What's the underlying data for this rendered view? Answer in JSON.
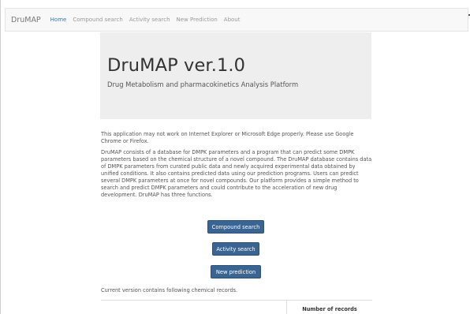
{
  "navbar": {
    "brand": "DruMAP",
    "items": [
      {
        "label": "Home",
        "active": true
      },
      {
        "label": "Compound search",
        "active": false
      },
      {
        "label": "Activity search",
        "active": false
      },
      {
        "label": "New Prediction",
        "active": false
      },
      {
        "label": "About",
        "active": false
      }
    ]
  },
  "jumbotron": {
    "title": "DruMAP ver.1.0",
    "subtitle": "Drug Metabolism and pharmacokinetics Analysis Platform"
  },
  "content": {
    "warning": "This application may not work on Internet Explorer or Microsoft Edge properly. Please use Google Chrome or Firefox.",
    "description": "DruMAP consists of a database for DMPK parameters and a program that can predict some DMPK parameters based on the chemical structure of a novel compound. The DruMAP database contains data of DMPK parameters from curated public data and newly acquired experimental data obtained by unified conditions. It also contains predicted data using our prediction programs. Users can predict several DMPK parameters at once for novel compounds. Our platform provides a simple method to search and predict DMPK parameters and could contribute to the acceleration of new drug development. DruMAP has three functions."
  },
  "buttons": {
    "compound_search": "Compound search",
    "activity_search": "Activity search",
    "new_prediction": "New prediction"
  },
  "records": {
    "label": "Current version contains following chemical records.",
    "table_header_count": "Number of records"
  },
  "colors": {
    "accent": "#337ab7",
    "button": "#3a6592",
    "jumbotron_bg": "#eeeeee"
  }
}
